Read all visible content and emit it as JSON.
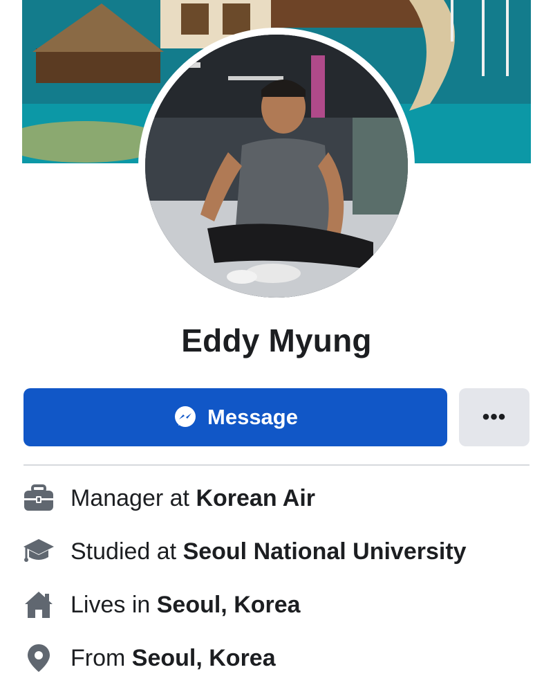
{
  "profile": {
    "name": "Eddy Myung"
  },
  "actions": {
    "message_label": "Message",
    "more_label": "•••"
  },
  "details": {
    "work": {
      "prefix": "Manager at ",
      "value": "Korean Air",
      "icon": "briefcase-icon"
    },
    "education": {
      "prefix": "Studied at ",
      "value": "Seoul National University",
      "icon": "graduation-cap-icon"
    },
    "current_city": {
      "prefix": "Lives in ",
      "value": "Seoul, Korea",
      "icon": "home-icon"
    },
    "hometown": {
      "prefix": "From ",
      "value": "Seoul, Korea",
      "icon": "location-pin-icon"
    }
  },
  "colors": {
    "primary_button": "#1157c7",
    "secondary_button": "#e4e6eb",
    "icon_gray": "#606770",
    "text": "#1c1e21"
  }
}
